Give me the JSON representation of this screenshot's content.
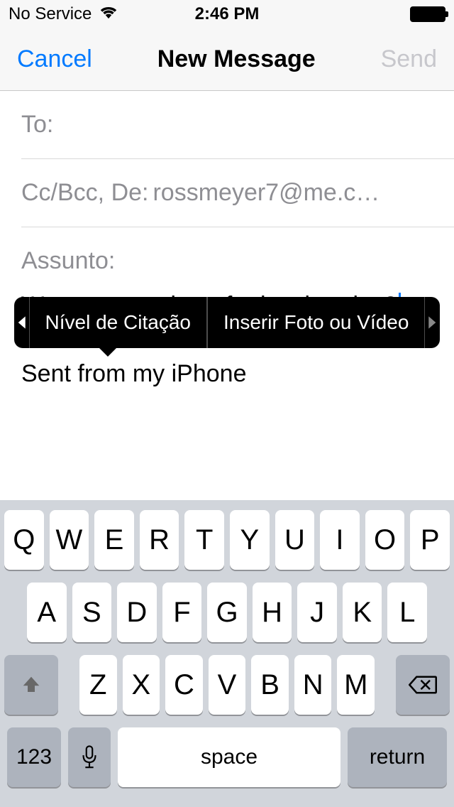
{
  "status": {
    "carrier": "No Service",
    "time": "2:46 PM"
  },
  "nav": {
    "cancel": "Cancel",
    "title": "New Message",
    "send": "Send"
  },
  "fields": {
    "to_label": "To:",
    "ccbcc_label": "Cc/Bcc, De:",
    "ccbcc_value": "rossmeyer7@me.c…",
    "subject_label": "Assunto:"
  },
  "body": {
    "text": "Want to meet here for lunch today?",
    "signature": "Sent from my iPhone"
  },
  "edit_menu": {
    "item1": "Nível de Citação",
    "item2": "Inserir Foto ou Vídeo"
  },
  "keyboard": {
    "row1": [
      "Q",
      "W",
      "E",
      "R",
      "T",
      "Y",
      "U",
      "I",
      "O",
      "P"
    ],
    "row2": [
      "A",
      "S",
      "D",
      "F",
      "G",
      "H",
      "J",
      "K",
      "L"
    ],
    "row3": [
      "Z",
      "X",
      "C",
      "V",
      "B",
      "N",
      "M"
    ],
    "numkey": "123",
    "space": "space",
    "return": "return"
  }
}
